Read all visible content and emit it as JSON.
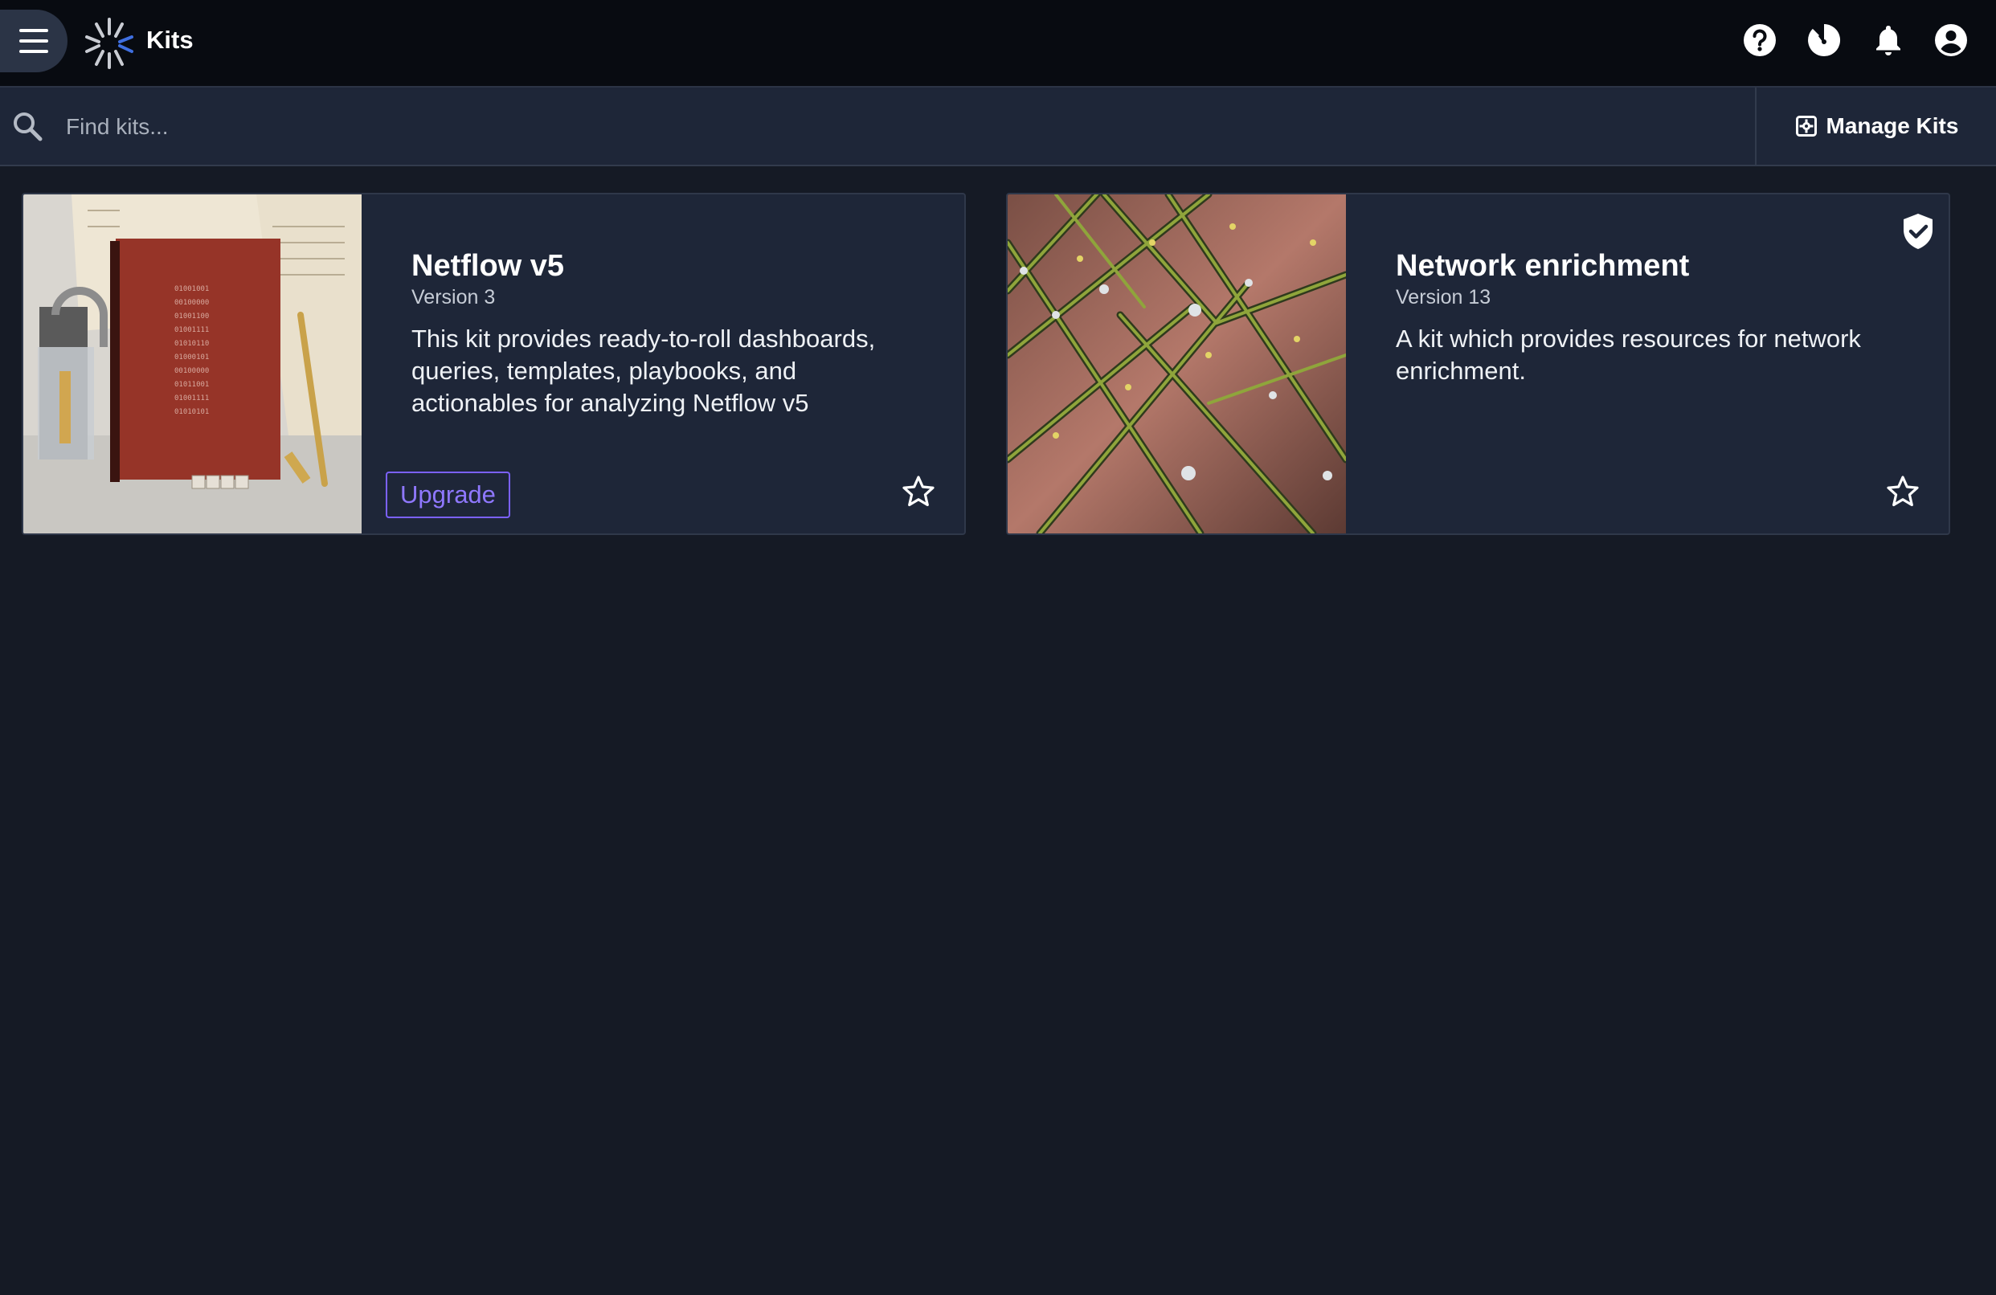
{
  "header": {
    "title": "Kits",
    "icons": [
      "menu-icon",
      "help-icon",
      "timer-icon",
      "bell-icon",
      "account-icon"
    ]
  },
  "search": {
    "placeholder": "Find kits...",
    "value": ""
  },
  "toolbar": {
    "manage_label": "Manage Kits"
  },
  "kits": [
    {
      "title": "Netflow v5",
      "version": "Version 3",
      "description": "This kit provides ready-to-roll dashboards, queries, templates, playbooks, and actionables for analyzing Netflow v5",
      "action_label": "Upgrade",
      "verified": false,
      "starred": false
    },
    {
      "title": "Network enrichment",
      "version": "Version 13",
      "description": "A kit which provides resources for network enrichment.",
      "verified": true,
      "starred": false
    }
  ],
  "colors": {
    "topbar": "#080b11",
    "background": "#151a25",
    "card": "#1e2638",
    "accent": "#7b61ff"
  }
}
